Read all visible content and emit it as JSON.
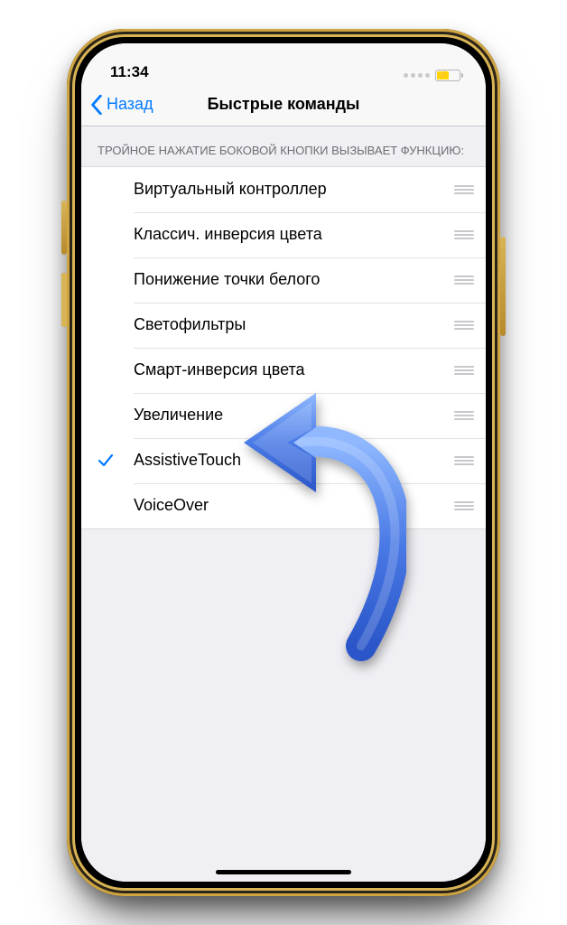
{
  "status": {
    "time": "11:34"
  },
  "nav": {
    "back_label": "Назад",
    "title": "Быстрые команды"
  },
  "section": {
    "header": "ТРОЙНОЕ НАЖАТИЕ БОКОВОЙ КНОПКИ ВЫЗЫВАЕТ ФУНКЦИЮ:"
  },
  "rows": [
    {
      "label": "Виртуальный контроллер",
      "checked": false
    },
    {
      "label": "Классич. инверсия цвета",
      "checked": false
    },
    {
      "label": "Понижение точки белого",
      "checked": false
    },
    {
      "label": "Светофильтры",
      "checked": false
    },
    {
      "label": "Смарт-инверсия цвета",
      "checked": false
    },
    {
      "label": "Увеличение",
      "checked": false
    },
    {
      "label": "AssistiveTouch",
      "checked": true
    },
    {
      "label": "VoiceOver",
      "checked": false
    }
  ],
  "colors": {
    "accent": "#007aff"
  }
}
